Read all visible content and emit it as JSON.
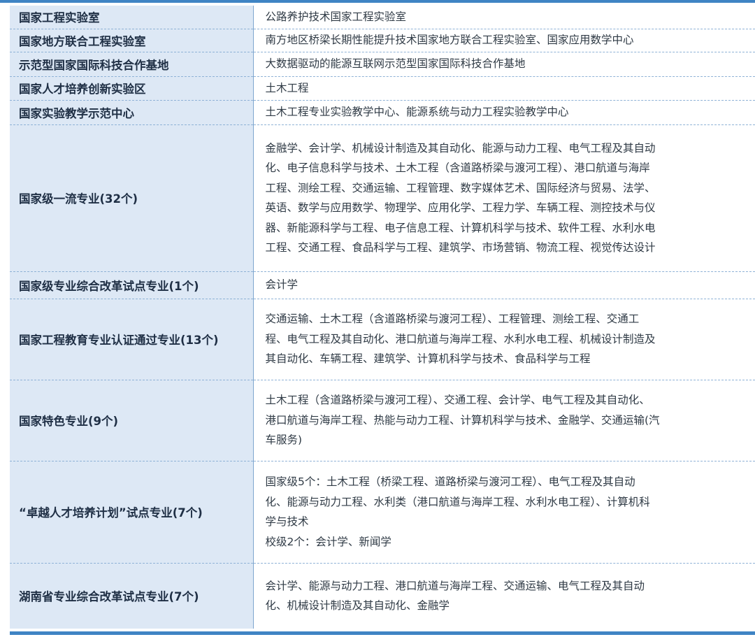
{
  "rows": [
    {
      "label": "国家工程实验室",
      "value": [
        "公路养护技术国家工程实验室"
      ]
    },
    {
      "label": "国家地方联合工程实验室",
      "value": [
        "南方地区桥梁长期性能提升技术国家地方联合工程实验室、国家应用数学中心"
      ]
    },
    {
      "label": "示范型国家国际科技合作基地",
      "value": [
        "大数据驱动的能源互联网示范型国家国际科技合作基地"
      ]
    },
    {
      "label": "国家人才培养创新实验区",
      "value": [
        "土木工程"
      ]
    },
    {
      "label": "国家实验教学示范中心",
      "value": [
        "土木工程专业实验教学中心、能源系统与动力工程实验教学中心"
      ]
    },
    {
      "label": "国家级一流专业(32个)",
      "value": [
        "金融学、会计学、机械设计制造及其自动化、能源与动力工程、电气工程及其自动",
        "化、电子信息科学与技术、土木工程（含道路桥梁与渡河工程）、港口航道与海岸",
        "工程、测绘工程、交通运输、工程管理、数字媒体艺术、国际经济与贸易、法学、",
        "英语、数学与应用数学、物理学、应用化学、工程力学、车辆工程、测控技术与仪",
        "器、新能源科学与工程、电子信息工程、计算机科学与技术、软件工程、水利水电",
        "工程、交通工程、食品科学与工程、建筑学、市场营销、物流工程、视觉传达设计"
      ]
    },
    {
      "label": "国家级专业综合改革试点专业(1个)",
      "value": [
        "会计学"
      ]
    },
    {
      "label": "国家工程教育专业认证通过专业(13个)",
      "value": [
        "交通运输、土木工程（含道路桥梁与渡河工程）、工程管理、测绘工程、交通工",
        "程、电气工程及其自动化、港口航道与海岸工程、水利水电工程、机械设计制造及",
        "其自动化、车辆工程、建筑学、计算机科学与技术、食品科学与工程"
      ]
    },
    {
      "label": "国家特色专业(9个)",
      "value": [
        "土木工程（含道路桥梁与渡河工程）、交通工程、会计学、电气工程及其自动化、",
        "港口航道与海岸工程、热能与动力工程、计算机科学与技术、金融学、交通运输(汽",
        "车服务)"
      ]
    },
    {
      "label": "“卓越人才培养计划”试点专业(7个)",
      "value": [
        "国家级5个：土木工程（桥梁工程、道路桥梁与渡河工程）、电气工程及其自动",
        "化、能源与动力工程、水利类（港口航道与海岸工程、水利水电工程）、计算机科",
        "学与技术",
        "校级2个：会计学、新闻学"
      ]
    },
    {
      "label": "湖南省专业综合改革试点专业(7个)",
      "value": [
        "会计学、能源与动力工程、港口航道与海岸工程、交通运输、电气工程及其自动",
        "化、机械设计制造及其自动化、金融学"
      ]
    }
  ]
}
